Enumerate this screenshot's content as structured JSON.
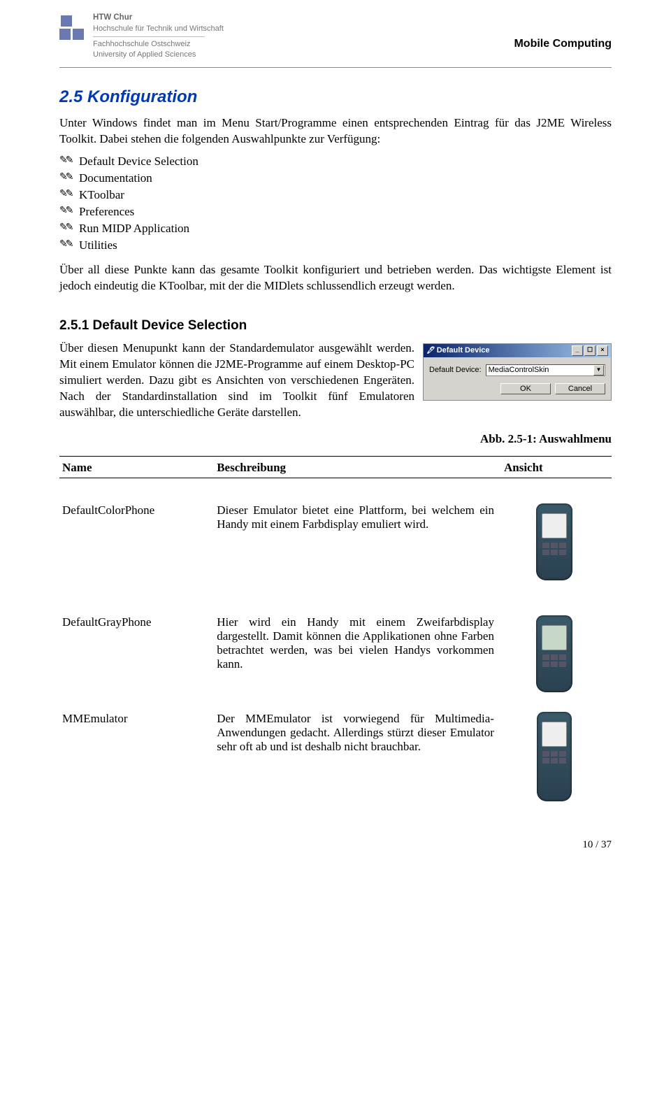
{
  "header": {
    "uni_bold": "HTW Chur",
    "uni_line1": "Hochschule für Technik und Wirtschaft",
    "uni_line2": "Fachhochschule Ostschweiz",
    "uni_line3": "University of Applied Sciences",
    "course": "Mobile Computing"
  },
  "section": {
    "num_title": "2.5   Konfiguration",
    "intro": "Unter Windows findet man im Menu Start/Programme einen entsprechenden Eintrag für das J2ME Wireless Toolkit. Dabei stehen die folgenden Auswahlpunkte zur Verfügung:",
    "bullets": [
      "Default Device Selection",
      "Documentation",
      "KToolbar",
      "Preferences",
      "Run MIDP Application",
      "Utilities"
    ],
    "after_bullets": "Über all diese Punkte kann das gesamte Toolkit konfiguriert und betrieben werden. Das wichtigste Element ist jedoch eindeutig die KToolbar, mit der die MIDlets schlussendlich erzeugt werden."
  },
  "subsection": {
    "num_title": "2.5.1  Default Device Selection",
    "para_lead": "Über diesen Menupunkt kann der Standardemulator ausgewählt werden. Mit einem Emulator können die J2ME-Programme auf einem Desktop-PC simuliert werden. Dazu gibt es Ansichten von verschiedenen Engeräten. Nach der Standardinstallation sind im Toolkit fünf Emulatoren auswählbar, die unterschiedliche Geräte darstellen.",
    "fig_caption": "Abb. 2.5-1: Auswahlmenu"
  },
  "dialog": {
    "title": "Default Device",
    "label": "Default Device:",
    "value": "MediaControlSkin",
    "ok": "OK",
    "cancel": "Cancel"
  },
  "table": {
    "h1": "Name",
    "h2": "Beschreibung",
    "h3": "Ansicht",
    "rows": [
      {
        "name": "DefaultColorPhone",
        "desc": "Dieser Emulator bietet eine Plattform, bei welchem ein Handy mit einem Farbdisplay emuliert wird.",
        "screen": "color"
      },
      {
        "name": "DefaultGrayPhone",
        "desc": "Hier wird ein Handy mit einem Zweifarbdisplay dargestellt. Damit können die Applikationen ohne Farben betrachtet werden, was bei vielen Handys vorkommen kann.",
        "screen": "gray"
      },
      {
        "name": "MMEmulator",
        "desc": "Der MMEmulator ist vorwiegend für Multimedia-Anwendungen gedacht. Allerdings stürzt dieser Emulator sehr oft ab und ist deshalb nicht brauchbar.",
        "screen": "long"
      }
    ]
  },
  "page_num": "10 / 37"
}
